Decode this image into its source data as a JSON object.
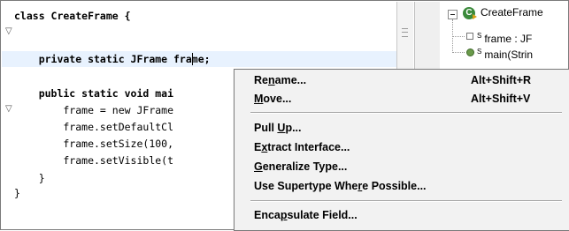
{
  "editor": {
    "lines": [
      {
        "fold": "▽",
        "code": "class CreateFrame {"
      },
      {
        "fold": "",
        "code": ""
      },
      {
        "fold": "",
        "code_before_caret": "    private static JFrame fra",
        "code_after_caret": "me;"
      },
      {
        "fold": "",
        "code": ""
      },
      {
        "fold": "▽",
        "code": "    public static void mai"
      },
      {
        "fold": "",
        "code": "        frame = new JFrame"
      },
      {
        "fold": "",
        "code": "        frame.setDefaultCl"
      },
      {
        "fold": "",
        "code": "        frame.setSize(100,"
      },
      {
        "fold": "",
        "code": "        frame.setVisible(t"
      },
      {
        "fold": "",
        "code": "    }"
      },
      {
        "fold": "",
        "code": "}"
      }
    ]
  },
  "outline": {
    "root": "CreateFrame",
    "items": [
      {
        "sup": "S",
        "label": "frame : JF"
      },
      {
        "sup": "S",
        "label": "main(Strin"
      }
    ]
  },
  "context_menu": {
    "items": [
      {
        "label": "Rename...",
        "accelerator": "Alt+Shift+R",
        "mnemonic_index": 2
      },
      {
        "label": "Move...",
        "accelerator": "Alt+Shift+V",
        "mnemonic_index": 0
      },
      {
        "label": "Pull Up...",
        "accelerator": "",
        "mnemonic_index": 5
      },
      {
        "label": "Extract Interface...",
        "accelerator": "",
        "mnemonic_index": 1
      },
      {
        "label": "Generalize Type...",
        "accelerator": "",
        "mnemonic_index": 0
      },
      {
        "label": "Use Supertype Where Possible...",
        "accelerator": "",
        "mnemonic_index": 17
      },
      {
        "label": "Encapsulate Field...",
        "accelerator": "",
        "mnemonic_index": 4
      }
    ]
  }
}
